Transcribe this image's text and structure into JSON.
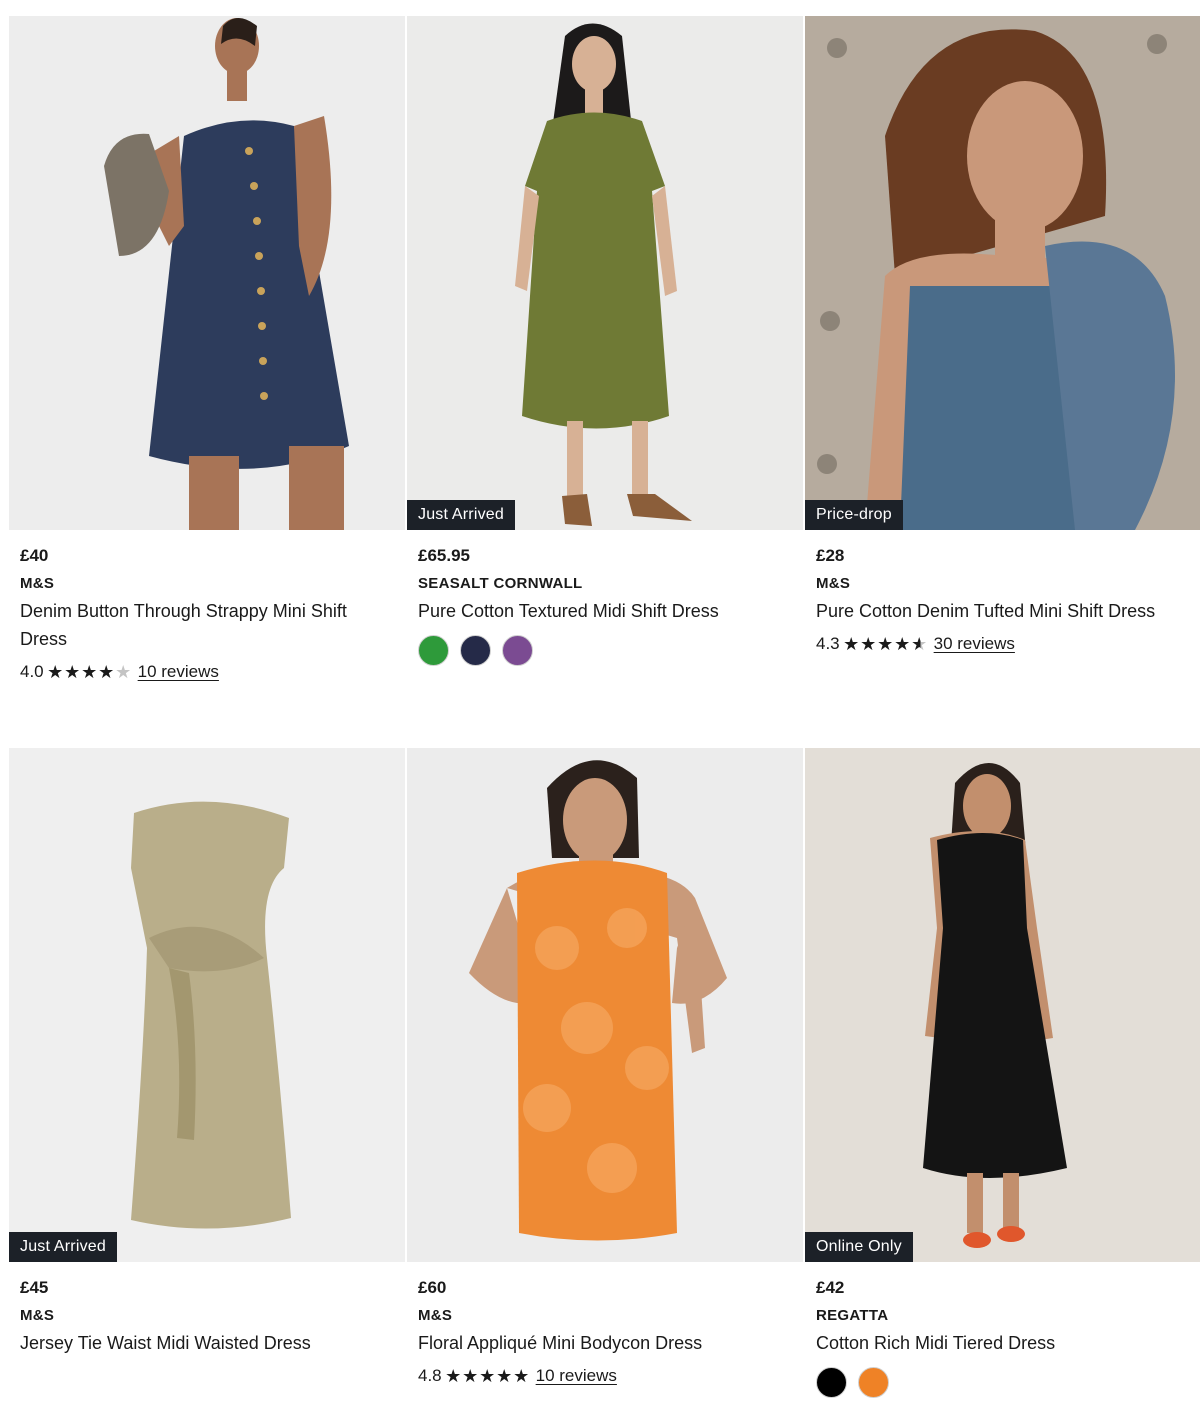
{
  "products": [
    {
      "price": "£40",
      "brand": "M&S",
      "title": "Denim Button Through Strappy Mini Shift Dress",
      "badge": "",
      "rating": "4.0",
      "stars": [
        "full",
        "full",
        "full",
        "full",
        "empty"
      ],
      "reviews": "10 reviews",
      "image_bg": "#ededed"
    },
    {
      "price": "£65.95",
      "brand": "SEASALT CORNWALL",
      "title": "Pure Cotton Textured Midi Shift Dress",
      "badge": "Just Arrived",
      "swatches": [
        "#2e9a3a",
        "#252a48",
        "#7b4b92"
      ],
      "image_bg": "#ebebea"
    },
    {
      "price": "£28",
      "brand": "M&S",
      "title": "Pure Cotton Denim Tufted Mini Shift Dress",
      "badge": "Price-drop",
      "rating": "4.3",
      "stars": [
        "full",
        "full",
        "full",
        "full",
        "half"
      ],
      "reviews": "30 reviews",
      "image_bg": "#b6ab9e"
    },
    {
      "price": "£45",
      "brand": "M&S",
      "title": "Jersey Tie Waist Midi Waisted Dress",
      "badge": "Just Arrived",
      "image_bg": "#efefef"
    },
    {
      "price": "£60",
      "brand": "M&S",
      "title": "Floral Appliqué Mini Bodycon Dress",
      "badge": "",
      "rating": "4.8",
      "stars": [
        "full",
        "full",
        "full",
        "full",
        "full"
      ],
      "reviews": "10 reviews",
      "image_bg": "#ececec"
    },
    {
      "price": "£42",
      "brand": "REGATTA",
      "title": "Cotton Rich Midi Tiered Dress",
      "badge": "Online Only",
      "swatches": [
        "#000000",
        "#ef8226"
      ],
      "image_bg": "#e3ded7"
    }
  ]
}
